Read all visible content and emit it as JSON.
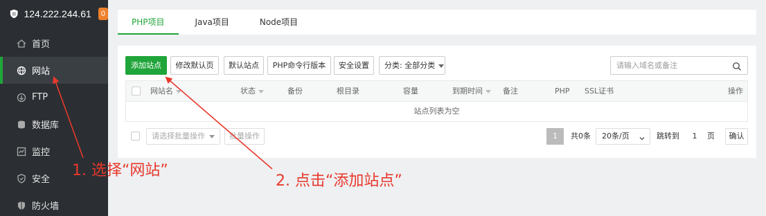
{
  "server": {
    "ip": "124.222.244.61",
    "badge": "0"
  },
  "sidebar": {
    "items": [
      {
        "label": "首页",
        "icon": "home-icon"
      },
      {
        "label": "网站",
        "icon": "globe-icon",
        "active": true
      },
      {
        "label": "FTP",
        "icon": "ftp-icon"
      },
      {
        "label": "数据库",
        "icon": "database-icon"
      },
      {
        "label": "监控",
        "icon": "monitor-icon"
      },
      {
        "label": "安全",
        "icon": "shield-icon"
      },
      {
        "label": "防火墙",
        "icon": "firewall-icon"
      }
    ]
  },
  "tabs": [
    {
      "label": "PHP项目",
      "active": true
    },
    {
      "label": "Java项目"
    },
    {
      "label": "Node项目"
    }
  ],
  "toolbar": {
    "add_site": "添加站点",
    "edit_default_page": "修改默认页",
    "default_site": "默认站点",
    "php_cli_version": "PHP命令行版本",
    "security_settings": "安全设置",
    "category_select": "分类: 全部分类"
  },
  "search": {
    "placeholder": "请输入域名或备注"
  },
  "table": {
    "columns": [
      "网站名",
      "状态",
      "备份",
      "根目录",
      "容量",
      "到期时间",
      "备注",
      "PHP",
      "SSL证书",
      "操作"
    ],
    "empty_text": "站点列表为空"
  },
  "footer": {
    "batch_placeholder": "请选择批量操作",
    "batch_button": "批量操作",
    "current_page": "1",
    "total": "共0条",
    "page_size": "20条/页",
    "jump_label": "跳转到",
    "jump_value": "1",
    "page_unit": "页",
    "confirm": "确认"
  },
  "annotations": {
    "step1": "1. 选择“网站”",
    "step2": "2. 点击“添加站点”",
    "color": "#e8382b"
  },
  "colors": {
    "accent": "#20a53a",
    "sidebar_bg": "#2b2f33",
    "badge": "#f0812c"
  }
}
